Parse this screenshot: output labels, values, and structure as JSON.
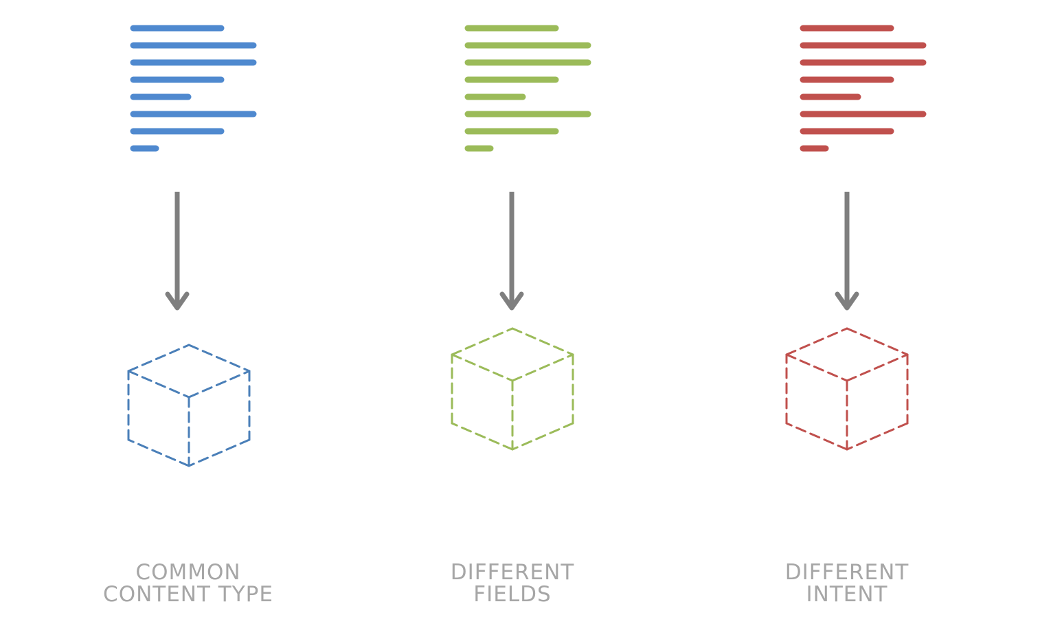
{
  "columns": [
    {
      "id": "common",
      "color": "#4f89cf",
      "cube_color": "#4a7fb8",
      "caption_lines": [
        "COMMON",
        "CONTENT TYPE"
      ]
    },
    {
      "id": "fields",
      "color": "#9bbb59",
      "cube_color": "#9bbb59",
      "caption_lines": [
        "DIFFERENT",
        "FIELDS"
      ]
    },
    {
      "id": "intent",
      "color": "#c0504d",
      "cube_color": "#c0504d",
      "caption_lines": [
        "DIFFERENT",
        "INTENT"
      ]
    }
  ],
  "arrow_color": "#7f7f7f",
  "caption_color": "#a6a6a6"
}
